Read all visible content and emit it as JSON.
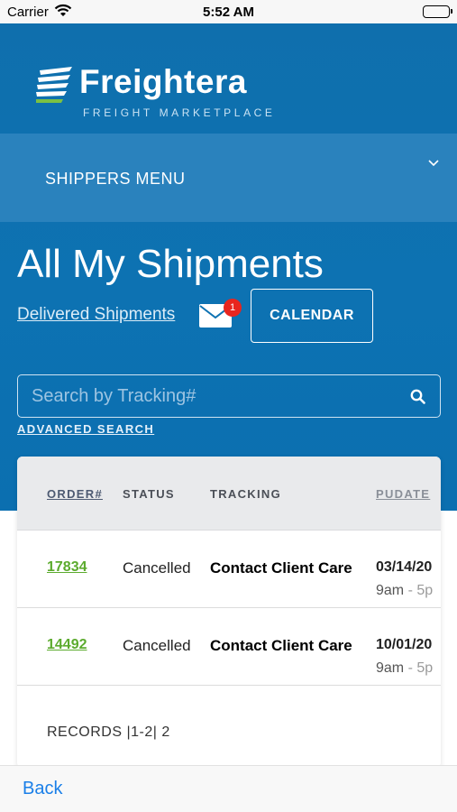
{
  "status_bar": {
    "carrier": "Carrier",
    "time": "5:52 AM"
  },
  "brand": {
    "name": "Freightera",
    "tagline": "FREIGHT MARKETPLACE"
  },
  "menu": {
    "label": "SHIPPERS MENU",
    "icon": "chevron-down-icon"
  },
  "page": {
    "title": "All My Shipments",
    "delivered_link": "Delivered Shipments",
    "mail_badge": "1",
    "calendar_button": "CALENDAR"
  },
  "search": {
    "placeholder": "Search by Tracking#",
    "advanced": "ADVANCED SEARCH"
  },
  "table": {
    "headers": {
      "order": "ORDER#",
      "status": "STATUS",
      "tracking": "TRACKING",
      "pudate": "PUDATE"
    },
    "rows": [
      {
        "order": "17834",
        "status": "Cancelled",
        "tracking": "Contact Client Care",
        "pudate": "03/14/20",
        "window_start": "9am",
        "window_sep": " - 5p"
      },
      {
        "order": "14492",
        "status": "Cancelled",
        "tracking": "Contact Client Care",
        "pudate": "10/01/20",
        "window_start": "9am",
        "window_sep": " - 5p"
      }
    ],
    "records": "RECORDS |1-2| 2"
  },
  "bottom": {
    "back": "Back"
  },
  "colors": {
    "primary": "#0d72b2",
    "menu": "#2a82bd",
    "order_link": "#5cab2e",
    "badge": "#e8251e",
    "back_link": "#1a7fe8"
  }
}
